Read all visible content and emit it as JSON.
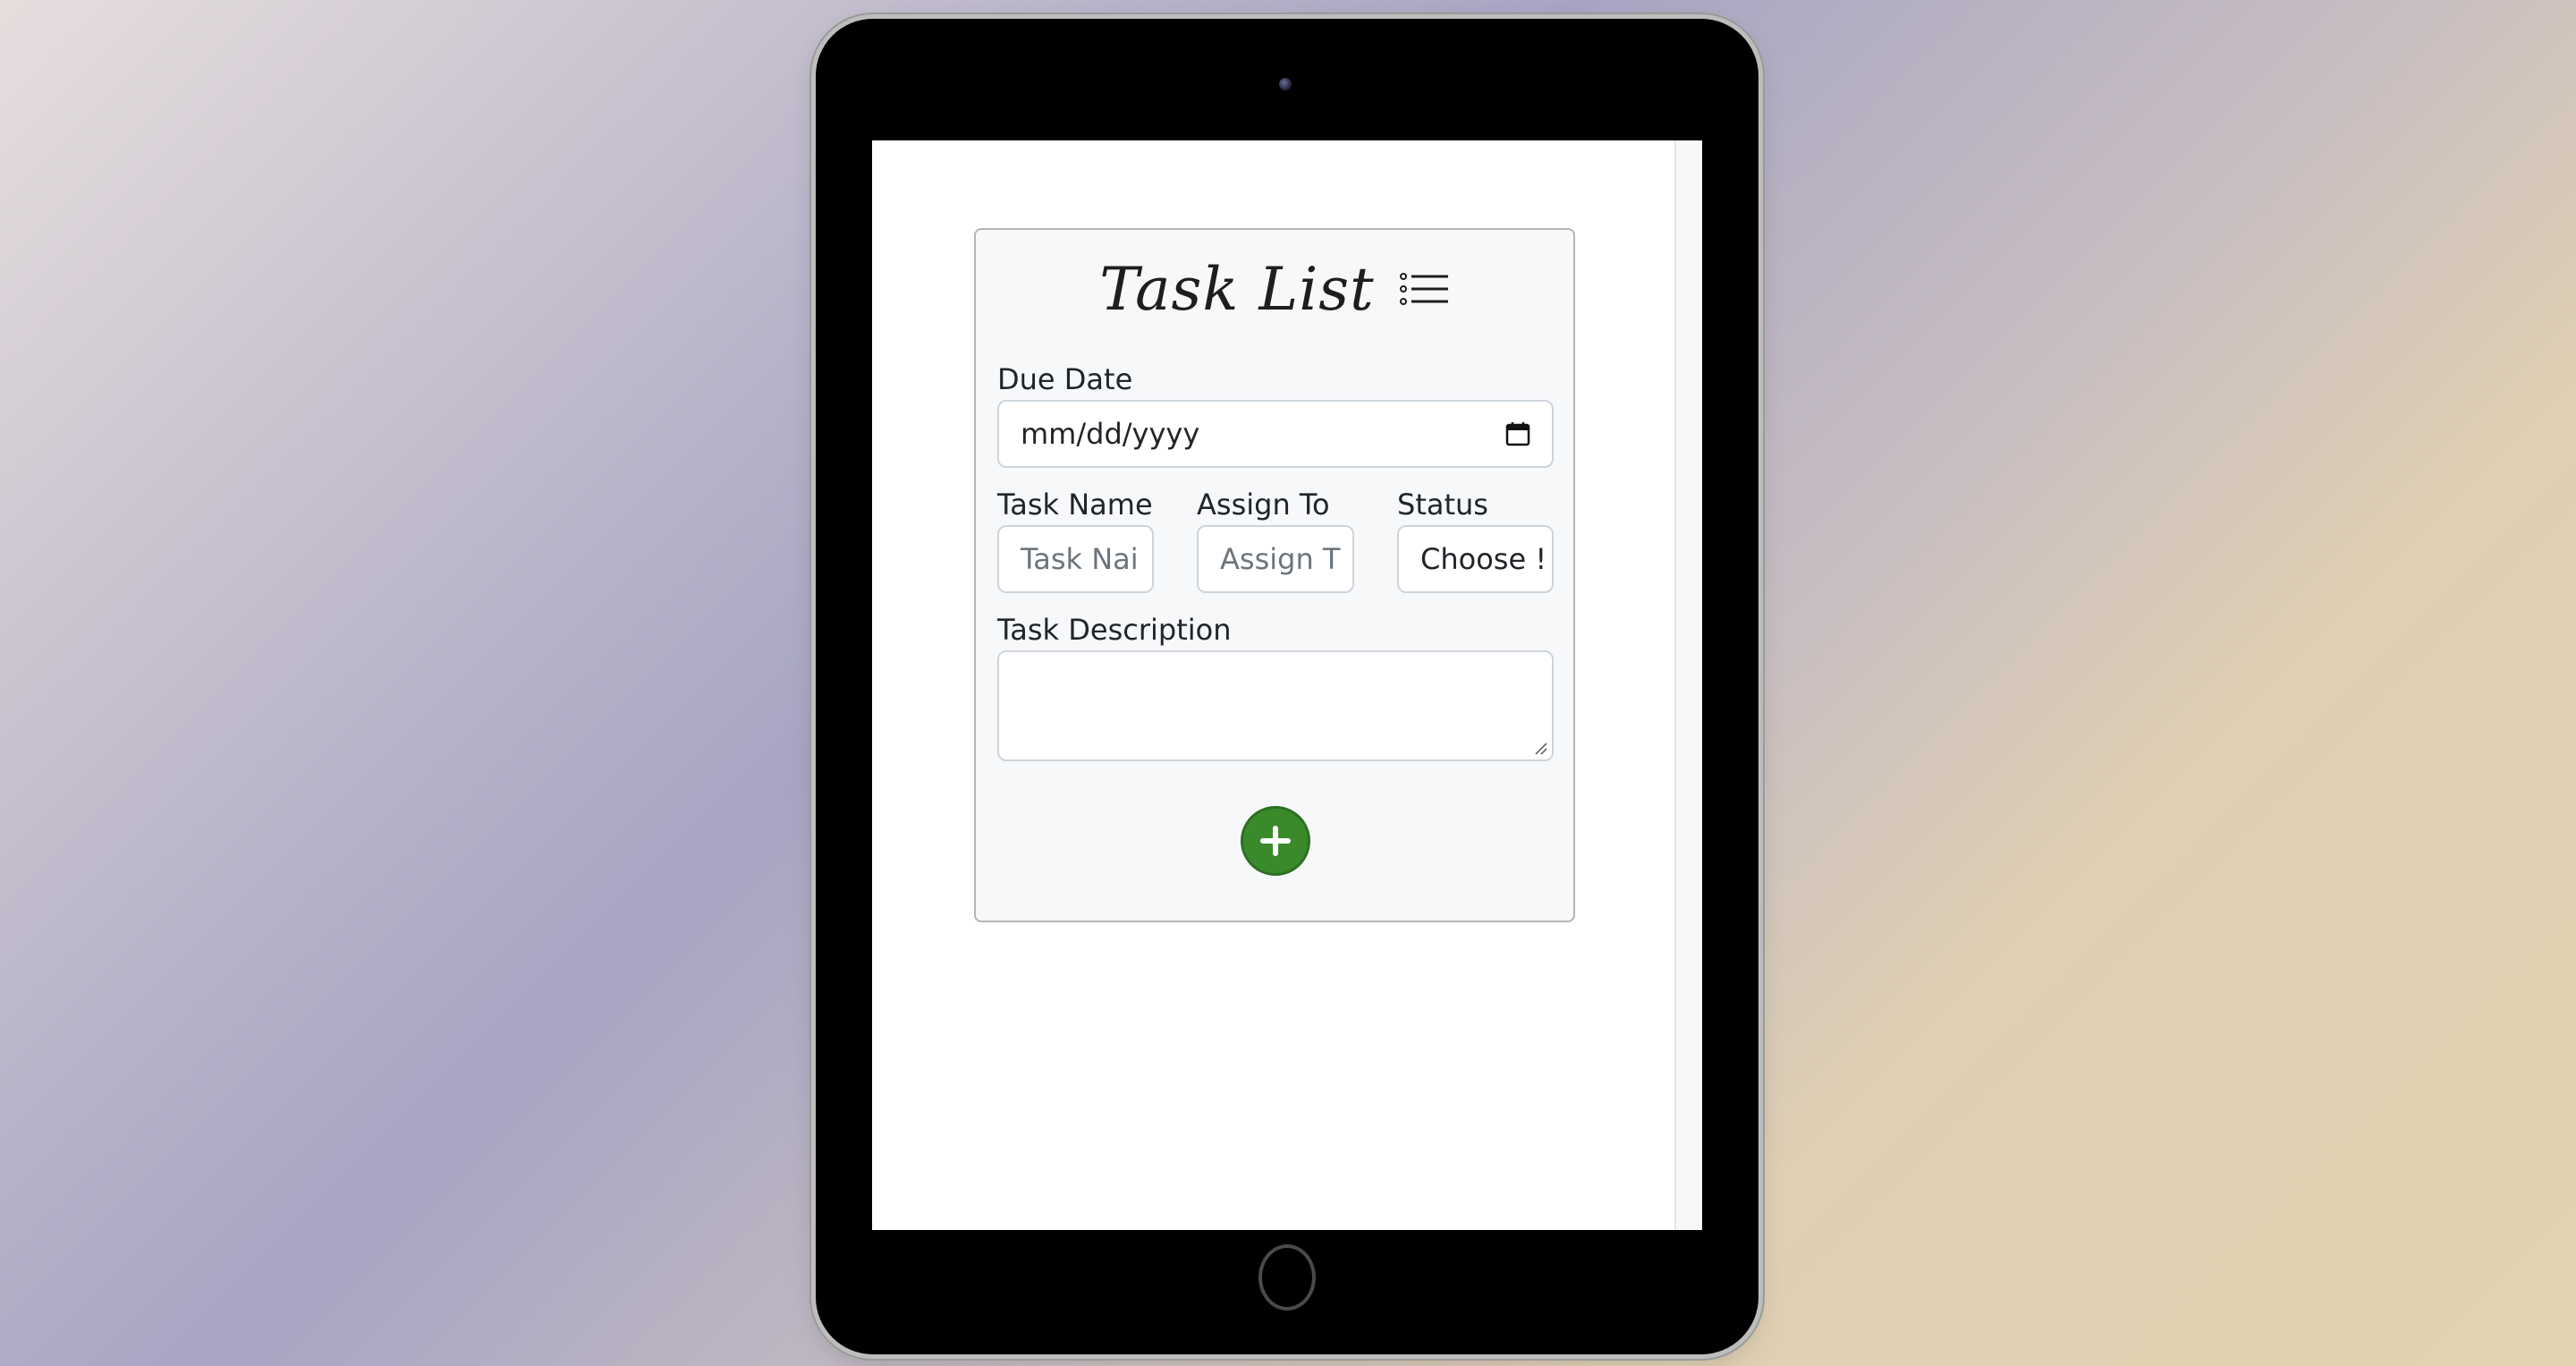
{
  "app": {
    "title": "Task List",
    "title_icon": "list-icon"
  },
  "form": {
    "due_date": {
      "label": "Due Date",
      "value": "mm/dd/yyyy",
      "icon": "calendar-icon"
    },
    "task_name": {
      "label": "Task Name",
      "placeholder": "Task Nai"
    },
    "assign_to": {
      "label": "Assign To",
      "placeholder": "Assign T"
    },
    "status": {
      "label": "Status",
      "value": "Choose !"
    },
    "task_description": {
      "label": "Task Description",
      "value": ""
    },
    "add_button": {
      "icon": "plus-icon",
      "color": "#3a8a2c"
    }
  }
}
